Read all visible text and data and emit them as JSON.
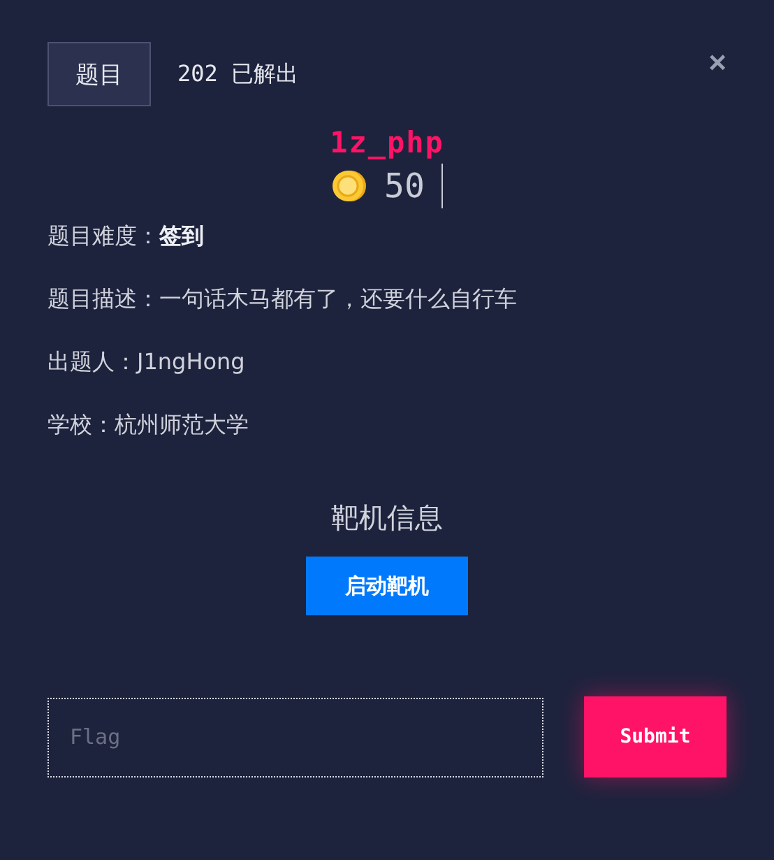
{
  "tabs": [
    {
      "label": "题目",
      "selected": true
    }
  ],
  "solved": "202 已解出",
  "close": "×",
  "challenge": {
    "name": "1z_php",
    "points": "50"
  },
  "info": [
    "题目难度：**签到**",
    "题目描述：一句话木马都有了，还要什么自行车",
    "出题人：J1ngHong",
    "学校：杭州师范大学"
  ],
  "target": {
    "title": "靶机信息",
    "button": "启动靶机"
  },
  "flag": {
    "placeholder": "Flag",
    "submit": "Submit"
  }
}
